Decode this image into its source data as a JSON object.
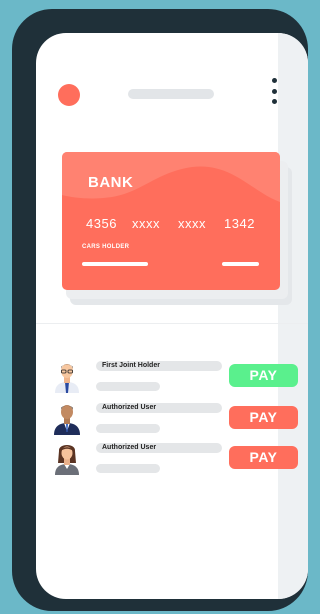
{
  "card": {
    "bank_name": "BANK",
    "number_groups": [
      "4356",
      "xxxx",
      "xxxx",
      "1342"
    ],
    "holder_label": "CARS HOLDER",
    "color": "#ff6e5c"
  },
  "users": [
    {
      "name": "First Joint Holder",
      "pay_label": "PAY",
      "pay_color": "#5af08d",
      "avatar": "man-with-glasses"
    },
    {
      "name": "Authorized User",
      "pay_label": "PAY",
      "pay_color": "#ff6e5c",
      "avatar": "man-in-suit"
    },
    {
      "name": "Authorized User",
      "pay_label": "PAY",
      "pay_color": "#ff6e5c",
      "avatar": "woman"
    }
  ],
  "colors": {
    "background": "#6bb8c8",
    "phone_frame": "#1f3039",
    "accent": "#ff6e5c",
    "pay_green": "#5af08d"
  }
}
